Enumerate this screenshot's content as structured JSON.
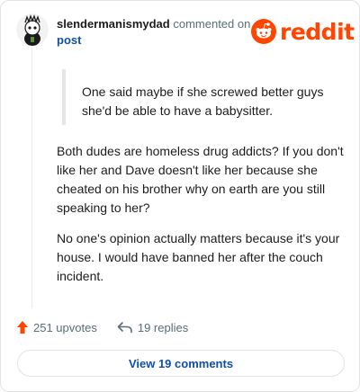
{
  "comment": {
    "username": "slendermanismydad",
    "action_text": "commented on",
    "post_link": "post",
    "quote": "One said maybe if she screwed better guys she'd be able to have a babysitter.",
    "paragraphs": [
      "Both dudes are homeless drug addicts? If you don't like her and Dave doesn't like her because she cheated on his brother why on earth are you still speaking to her?",
      "No one's opinion actually matters because it's your house. I would have banned her after the couch incident."
    ],
    "upvotes_label": "251 upvotes",
    "replies_label": "19 replies",
    "view_comments_label": "View 19 comments"
  },
  "brand": {
    "wordmark": "reddit",
    "color": "#ff4500"
  },
  "icons": {
    "upvote": "upvote-arrow-icon",
    "reply": "reply-arrow-icon",
    "logo": "reddit-snoo-icon",
    "avatar": "snoo-avatar-icon"
  }
}
